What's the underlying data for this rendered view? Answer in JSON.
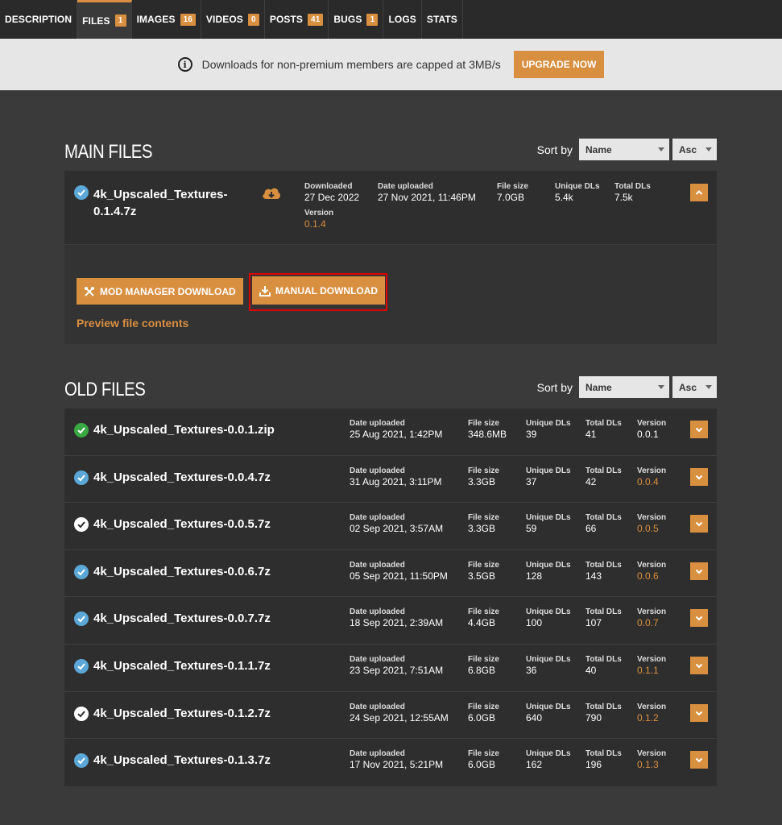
{
  "tabs": [
    {
      "label": "DESCRIPTION",
      "badge": null,
      "active": false
    },
    {
      "label": "FILES",
      "badge": "1",
      "active": true
    },
    {
      "label": "IMAGES",
      "badge": "16",
      "active": false
    },
    {
      "label": "VIDEOS",
      "badge": "0",
      "active": false
    },
    {
      "label": "POSTS",
      "badge": "41",
      "active": false
    },
    {
      "label": "BUGS",
      "badge": "1",
      "active": false
    },
    {
      "label": "LOGS",
      "badge": null,
      "active": false
    },
    {
      "label": "STATS",
      "badge": null,
      "active": false
    }
  ],
  "notice": {
    "text": "Downloads for non-premium members are capped at 3MB/s",
    "upgrade_label": "UPGRADE NOW"
  },
  "main_files": {
    "title": "MAIN FILES",
    "sort_label": "Sort by",
    "sort_field": "Name",
    "sort_order": "Asc",
    "file": {
      "name_line1": "4k_Upscaled_Textures-",
      "name_line2": "0.1.4.7z",
      "downloaded_label": "Downloaded",
      "downloaded": "27 Dec 2022",
      "uploaded_label": "Date uploaded",
      "uploaded": "27 Nov 2021, 11:46PM",
      "size_label": "File size",
      "size": "7.0GB",
      "unique_label": "Unique DLs",
      "unique": "5.4k",
      "total_label": "Total DLs",
      "total": "7.5k",
      "version_label": "Version",
      "version": "0.1.4",
      "mod_manager_label": "MOD MANAGER DOWNLOAD",
      "manual_label": "MANUAL DOWNLOAD",
      "preview_label": "Preview file contents"
    }
  },
  "old_files": {
    "title": "OLD FILES",
    "sort_label": "Sort by",
    "sort_field": "Name",
    "sort_order": "Asc",
    "labels": {
      "uploaded": "Date uploaded",
      "size": "File size",
      "unique": "Unique DLs",
      "total": "Total DLs",
      "version": "Version"
    },
    "rows": [
      {
        "name": "4k_Upscaled_Textures-0.0.1.zip",
        "status": "green",
        "uploaded": "25 Aug 2021, 1:42PM",
        "size": "348.6MB",
        "unique": "39",
        "total": "41",
        "version": "0.0.1",
        "version_orange": false
      },
      {
        "name": "4k_Upscaled_Textures-0.0.4.7z",
        "status": "blue",
        "uploaded": "31 Aug 2021, 3:11PM",
        "size": "3.3GB",
        "unique": "37",
        "total": "42",
        "version": "0.0.4",
        "version_orange": true
      },
      {
        "name": "4k_Upscaled_Textures-0.0.5.7z",
        "status": "white",
        "uploaded": "02 Sep 2021, 3:57AM",
        "size": "3.3GB",
        "unique": "59",
        "total": "66",
        "version": "0.0.5",
        "version_orange": true
      },
      {
        "name": "4k_Upscaled_Textures-0.0.6.7z",
        "status": "blue",
        "uploaded": "05 Sep 2021, 11:50PM",
        "size": "3.5GB",
        "unique": "128",
        "total": "143",
        "version": "0.0.6",
        "version_orange": true
      },
      {
        "name": "4k_Upscaled_Textures-0.0.7.7z",
        "status": "blue",
        "uploaded": "18 Sep 2021, 2:39AM",
        "size": "4.4GB",
        "unique": "100",
        "total": "107",
        "version": "0.0.7",
        "version_orange": true
      },
      {
        "name": "4k_Upscaled_Textures-0.1.1.7z",
        "status": "blue",
        "uploaded": "23 Sep 2021, 7:51AM",
        "size": "6.8GB",
        "unique": "36",
        "total": "40",
        "version": "0.1.1",
        "version_orange": true
      },
      {
        "name": "4k_Upscaled_Textures-0.1.2.7z",
        "status": "white",
        "uploaded": "24 Sep 2021, 12:55AM",
        "size": "6.0GB",
        "unique": "640",
        "total": "790",
        "version": "0.1.2",
        "version_orange": true
      },
      {
        "name": "4k_Upscaled_Textures-0.1.3.7z",
        "status": "blue",
        "uploaded": "17 Nov 2021, 5:21PM",
        "size": "6.0GB",
        "unique": "162",
        "total": "196",
        "version": "0.1.3",
        "version_orange": true
      }
    ]
  },
  "colors": {
    "accent": "#d98f40",
    "check_blue": "#5ba8d8",
    "check_green": "#3aa843",
    "highlight_red": "#e00000"
  }
}
